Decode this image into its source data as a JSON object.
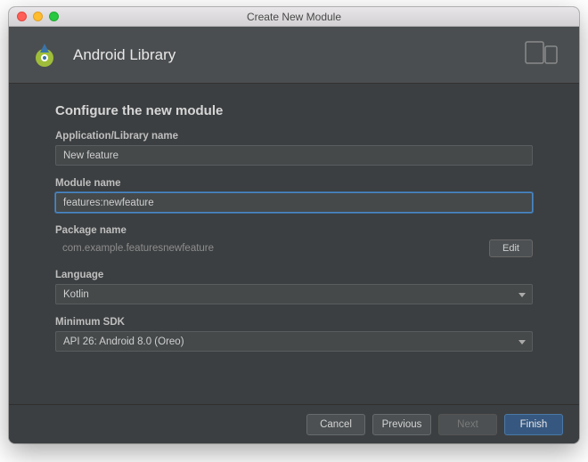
{
  "window": {
    "title": "Create New Module"
  },
  "header": {
    "title": "Android Library"
  },
  "form": {
    "section_title": "Configure the new module",
    "app_name_label": "Application/Library name",
    "app_name_value": "New feature",
    "module_name_label": "Module name",
    "module_name_value": "features:newfeature",
    "package_label": "Package name",
    "package_value": "com.example.featuresnewfeature",
    "edit_label": "Edit",
    "language_label": "Language",
    "language_value": "Kotlin",
    "min_sdk_label": "Minimum SDK",
    "min_sdk_value": "API 26: Android 8.0 (Oreo)"
  },
  "buttons": {
    "cancel": "Cancel",
    "previous": "Previous",
    "next": "Next",
    "finish": "Finish"
  }
}
